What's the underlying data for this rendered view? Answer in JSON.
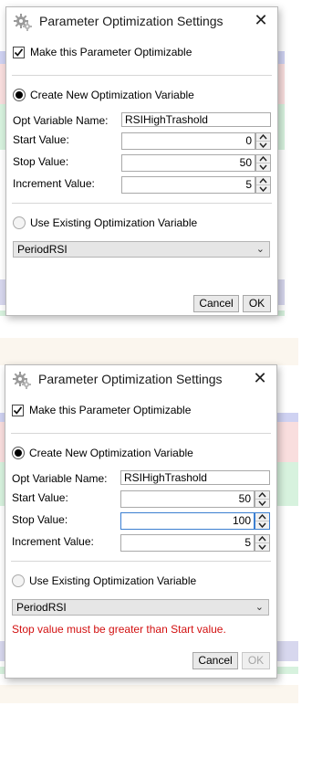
{
  "colors": {
    "error": "#d21010",
    "focus_border": "#3c7fd1",
    "background_stripes": [
      "#cfd2f2",
      "#f9dede",
      "#d7f2de",
      "#d7d7ee"
    ]
  },
  "dialogs": [
    {
      "title": "Parameter Optimization Settings",
      "gear_icon": "gear-icon",
      "close_icon": "close-icon",
      "close_glyph": "✕",
      "make_optimizable": {
        "label": "Make this Parameter Optimizable",
        "checked": true
      },
      "create_new": {
        "label": "Create New Optimization Variable",
        "selected": true
      },
      "opt_variable_name": {
        "label": "Opt Variable Name:",
        "value": "RSIHighTrashold"
      },
      "start_value": {
        "label": "Start Value:",
        "value": "0"
      },
      "stop_value": {
        "label": "Stop Value:",
        "value": "50"
      },
      "increment_value": {
        "label": "Increment Value:",
        "value": "5"
      },
      "use_existing": {
        "label": "Use Existing Optimization Variable",
        "selected": false
      },
      "existing_variable": {
        "value": "PeriodRSI",
        "chevron": "⌄"
      },
      "error": "",
      "cancel_label": "Cancel",
      "ok_label": "OK",
      "ok_enabled": true
    },
    {
      "title": "Parameter Optimization Settings",
      "gear_icon": "gear-icon",
      "close_icon": "close-icon",
      "close_glyph": "✕",
      "make_optimizable": {
        "label": "Make this Parameter Optimizable",
        "checked": true
      },
      "create_new": {
        "label": "Create New Optimization Variable",
        "selected": true
      },
      "opt_variable_name": {
        "label": "Opt Variable Name:",
        "value": "RSIHighTrashold"
      },
      "start_value": {
        "label": "Start Value:",
        "value": "50"
      },
      "stop_value": {
        "label": "Stop Value:",
        "value": "100"
      },
      "increment_value": {
        "label": "Increment Value:",
        "value": "5"
      },
      "use_existing": {
        "label": "Use Existing Optimization Variable",
        "selected": false
      },
      "existing_variable": {
        "value": "PeriodRSI",
        "chevron": "⌄"
      },
      "error": "Stop value must be greater than Start value.",
      "cancel_label": "Cancel",
      "ok_label": "OK",
      "ok_enabled": false
    }
  ]
}
